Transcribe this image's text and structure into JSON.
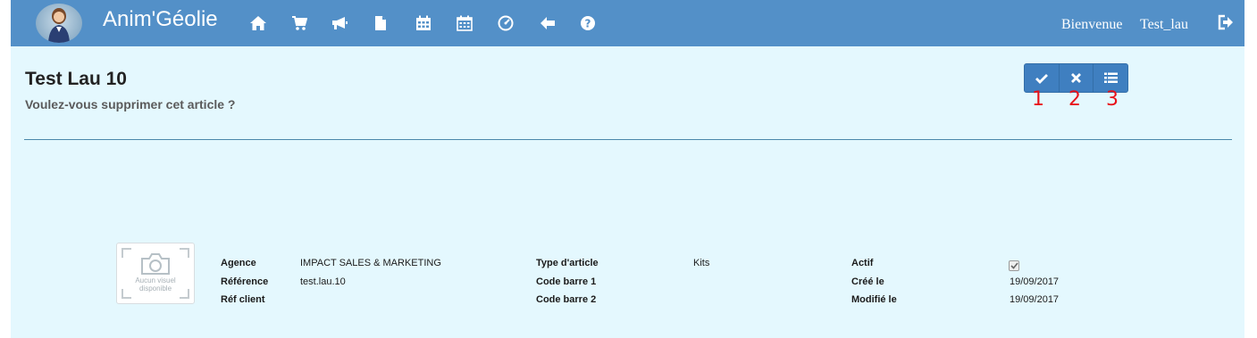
{
  "navbar": {
    "brand": "Anim'Géolie",
    "welcome": "Bienvenue",
    "username": "Test_lau",
    "icons": [
      "home-icon",
      "cart-icon",
      "megaphone-icon",
      "file-icon",
      "calendar-icon",
      "calendar-alt-icon",
      "dashboard-icon",
      "arrow-left-icon",
      "question-icon",
      "logout-icon"
    ]
  },
  "header": {
    "title": "Test Lau 10",
    "subtitle": "Voulez-vous supprimer cet article ?",
    "annotations": [
      "1",
      "2",
      "3"
    ]
  },
  "actions": {
    "icons": [
      "check-icon",
      "times-icon",
      "list-icon"
    ]
  },
  "thumbnail": {
    "text_line1": "Aucun visuel",
    "text_line2": "disponible"
  },
  "details": {
    "agence_label": "Agence",
    "agence_value": "IMPACT SALES & MARKETING",
    "reference_label": "Référence",
    "reference_value": "test.lau.10",
    "ref_client_label": "Réf client",
    "ref_client_value": "",
    "type_label": "Type d'article",
    "type_value": "Kits",
    "code1_label": "Code barre 1",
    "code1_value": "",
    "code2_label": "Code barre 2",
    "code2_value": "",
    "actif_label": "Actif",
    "actif_checked": true,
    "cree_label": "Créé le",
    "cree_value": "19/09/2017",
    "modifie_label": "Modifié le",
    "modifie_value": "19/09/2017"
  },
  "colors": {
    "navbar": "#5390c8",
    "background": "#e4f8fe",
    "button": "#3f7fc0",
    "annotation": "#e8121a"
  }
}
